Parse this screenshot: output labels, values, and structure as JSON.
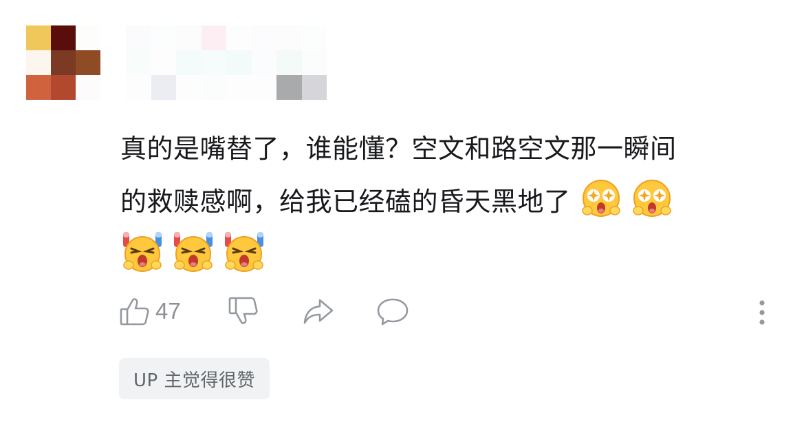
{
  "comment": {
    "line1": "真的是嘴替了，谁能懂？空文和路空文那一瞬间",
    "line2": "的救赎感啊，给我已经磕的昏天黑地了",
    "emojis_line2": [
      "starry-eyed-emoji",
      "starry-eyed-emoji"
    ],
    "emojis_line3": [
      "cheering-emoji",
      "cheering-emoji",
      "cheering-emoji"
    ]
  },
  "actions": {
    "like_count": "47",
    "icons": [
      "thumbs-up-icon",
      "thumbs-down-icon",
      "share-icon",
      "reply-icon",
      "more-icon"
    ]
  },
  "tag": {
    "label": "UP 主觉得很赞"
  },
  "colors": {
    "text": "#18191c",
    "icon": "#9499a0",
    "tag_bg": "#f1f2f3",
    "tag_text": "#61666d"
  }
}
